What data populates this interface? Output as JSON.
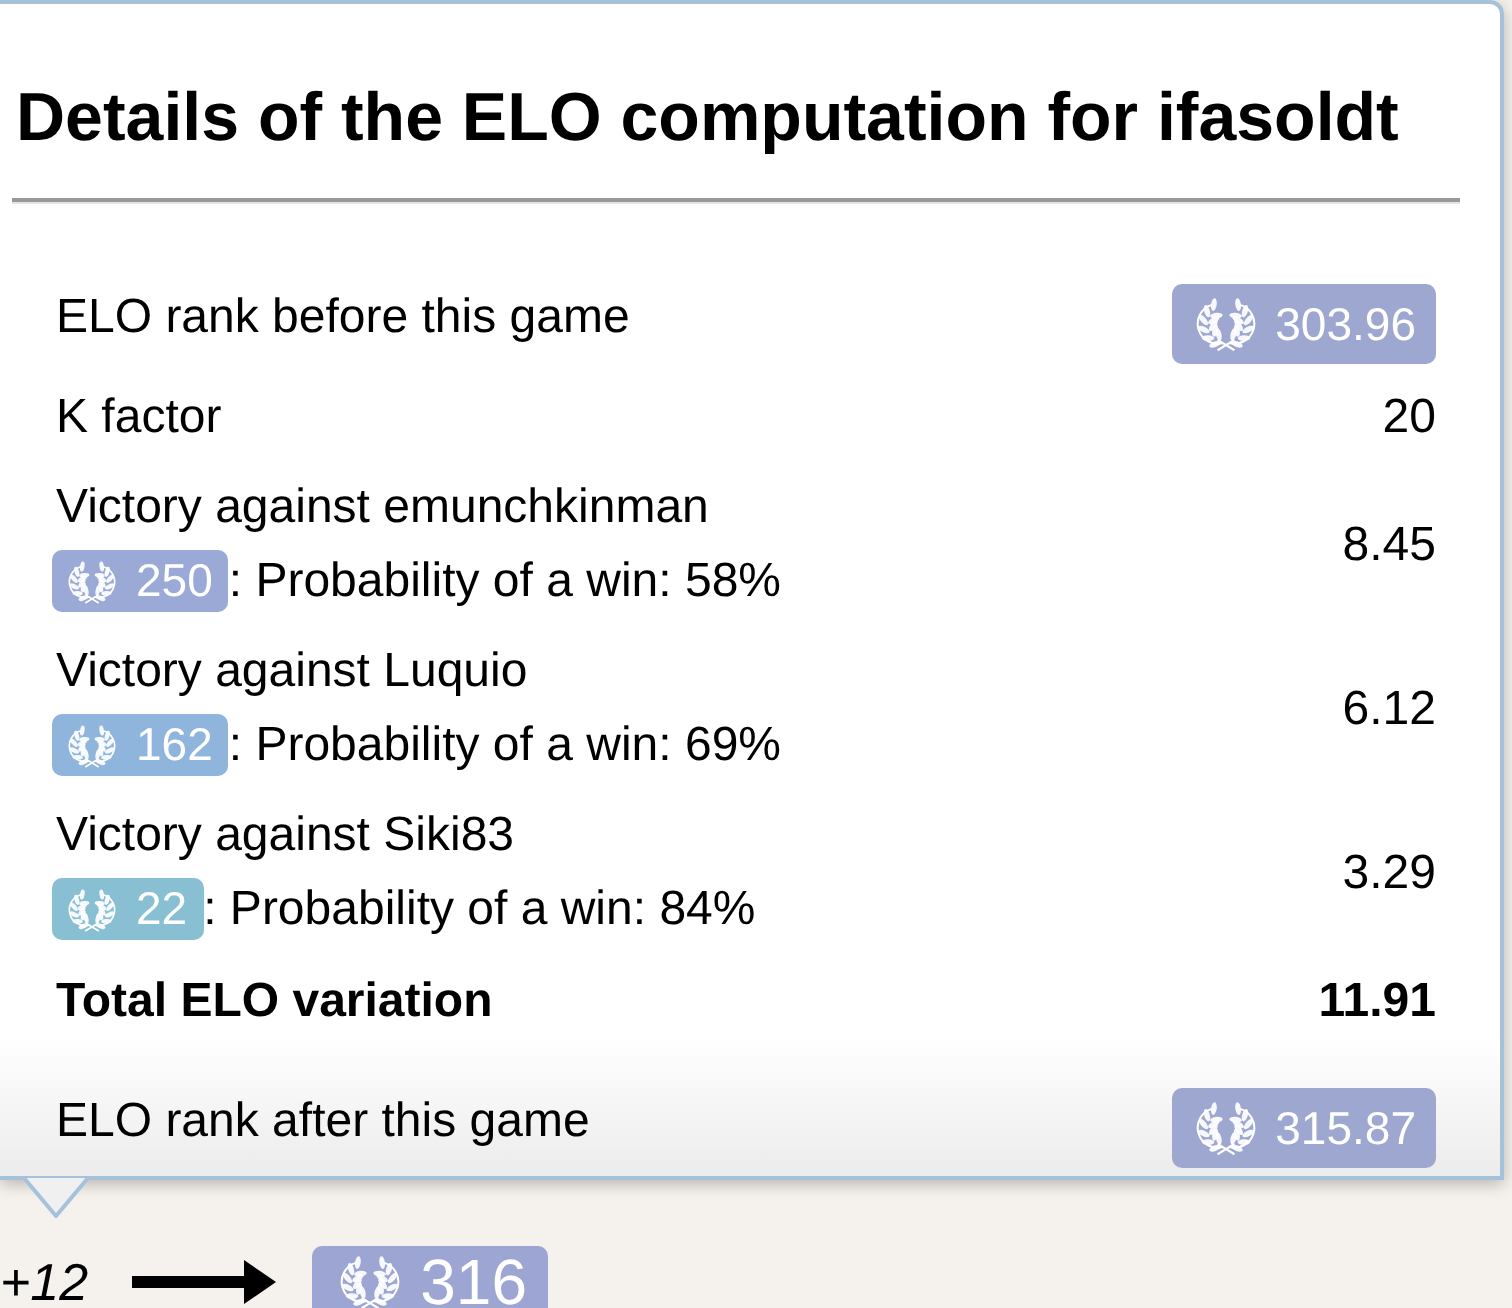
{
  "popup": {
    "title": "Details of the ELO computation for ifasoldt",
    "rows": [
      {
        "kind": "rank",
        "label": "ELO rank before this game",
        "badge": {
          "value": "303.96",
          "color": "#9ea7d0"
        }
      },
      {
        "kind": "value",
        "label": "K factor",
        "value": "20"
      },
      {
        "kind": "opponent",
        "label": "Victory against emunchkinman",
        "badge": {
          "value": "250",
          "color": "#9aa9d6"
        },
        "probability": ": Probability of a win: 58%",
        "value": "8.45"
      },
      {
        "kind": "opponent",
        "label": "Victory against Luquio",
        "badge": {
          "value": "162",
          "color": "#8fb5dc"
        },
        "probability": ": Probability of a win: 69%",
        "value": "6.12"
      },
      {
        "kind": "opponent",
        "label": "Victory against Siki83",
        "badge": {
          "value": "22",
          "color": "#89bfd3"
        },
        "probability": ": Probability of a win: 84%",
        "value": "3.29"
      },
      {
        "kind": "total",
        "label": "Total ELO variation",
        "value": "11.91"
      },
      {
        "kind": "rank",
        "label": "ELO rank after this game",
        "badge": {
          "value": "315.87",
          "color": "#9ea7d0"
        }
      }
    ]
  },
  "footer": {
    "change": "+12",
    "new_rank": {
      "value": "316",
      "color": "#9da6d2"
    }
  }
}
